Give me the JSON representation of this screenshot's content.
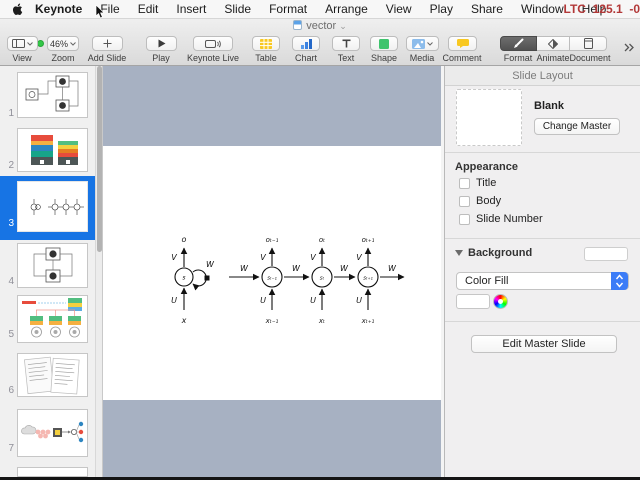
{
  "menu_bar": {
    "items": [
      "Keynote",
      "File",
      "Edit",
      "Insert",
      "Slide",
      "Format",
      "Arrange",
      "View",
      "Play",
      "Share",
      "Window",
      "Help"
    ],
    "status": "LTC  125.1  -0"
  },
  "window": {
    "title": "vector"
  },
  "toolbar": {
    "view": {
      "label": "View"
    },
    "zoom": {
      "label": "Zoom",
      "value": "46%"
    },
    "add_slide": {
      "label": "Add Slide"
    },
    "play": {
      "label": "Play"
    },
    "keynote_live": {
      "label": "Keynote Live"
    },
    "table": {
      "label": "Table"
    },
    "chart": {
      "label": "Chart"
    },
    "text": {
      "label": "Text"
    },
    "shape": {
      "label": "Shape"
    },
    "media": {
      "label": "Media"
    },
    "comment": {
      "label": "Comment"
    },
    "format": {
      "label": "Format"
    },
    "animate": {
      "label": "Animate"
    },
    "document": {
      "label": "Document"
    }
  },
  "sidebar": {
    "slides": [
      {
        "number": "1"
      },
      {
        "number": "2"
      },
      {
        "number": "3"
      },
      {
        "number": "4"
      },
      {
        "number": "5"
      },
      {
        "number": "6"
      },
      {
        "number": "7"
      }
    ],
    "selected_number": "3"
  },
  "inspector": {
    "title": "Slide Layout",
    "master_name": "Blank",
    "change_master_label": "Change Master",
    "appearance": {
      "heading": "Appearance",
      "options": [
        "Title",
        "Body",
        "Slide Number"
      ]
    },
    "background": {
      "heading": "Background",
      "fill_type": "Color Fill"
    },
    "edit_master_label": "Edit Master Slide"
  },
  "slide": {
    "diagram": {
      "left": {
        "output": "o",
        "state": "s",
        "input": "x",
        "v": "V",
        "w": "W",
        "u": "U"
      },
      "unfolded": {
        "outputs": [
          "oₜ₋₁",
          "oₜ",
          "oₜ₊₁"
        ],
        "states": [
          "sₜ₋₁",
          "sₜ",
          "sₜ₊₁"
        ],
        "inputs": [
          "xₜ₋₁",
          "xₜ",
          "xₜ₊₁"
        ],
        "w_labels": [
          "W",
          "W",
          "W",
          "W"
        ],
        "v_labels": [
          "V",
          "V",
          "V"
        ],
        "u_labels": [
          "U",
          "U",
          "U"
        ]
      }
    }
  },
  "colors": {
    "accent_blue": "#3b7cf7",
    "selection_blue": "#1774e4",
    "status_red": "#b23838"
  }
}
